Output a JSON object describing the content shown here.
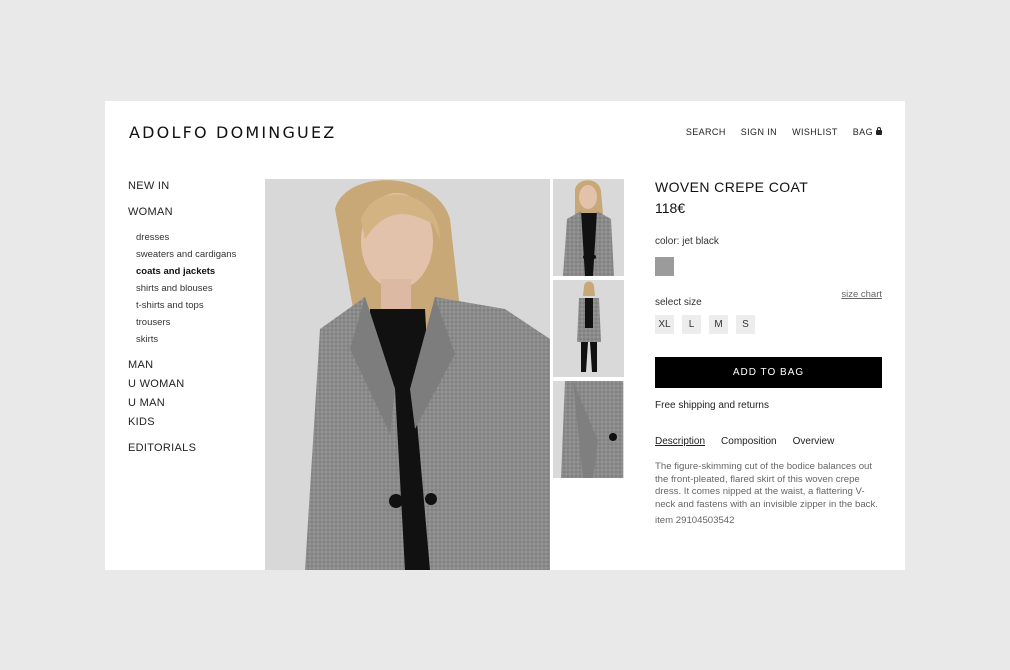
{
  "brand": {
    "logo": "ADOLFO DOMINGUEZ"
  },
  "topnav": {
    "search": "SEARCH",
    "sign_in": "SIGN IN",
    "wishlist": "WISHLIST",
    "bag": "BAG"
  },
  "sidebar": {
    "new_in": "NEW IN",
    "woman": "WOMAN",
    "woman_sub": [
      "dresses",
      "sweaters and cardigans",
      "coats and jackets",
      "shirts and blouses",
      "t-shirts and tops",
      "trousers",
      "skirts"
    ],
    "man": "MAN",
    "u_woman": "U WOMAN",
    "u_man": "U MAN",
    "kids": "KIDS",
    "editorials": "EDITORIALS"
  },
  "product": {
    "title": "WOVEN CREPE COAT",
    "price": "118€",
    "color_label": "color: jet black",
    "swatch_color": "#9b9b9b",
    "select_size": "select size",
    "size_chart": "size chart",
    "sizes": [
      "XL",
      "L",
      "M",
      "S"
    ],
    "add_to_bag": "ADD TO BAG",
    "shipping": "Free shipping and returns",
    "tabs": [
      "Description",
      "Composition",
      "Overview"
    ],
    "description": "The figure-skimming cut of the bodice balances out the front-pleated, flared skirt of this woven crepe dress. It comes nipped at the waist, a flattering V-neck and fastens with an invisible zipper in the back.",
    "item": "item 29104503542"
  }
}
